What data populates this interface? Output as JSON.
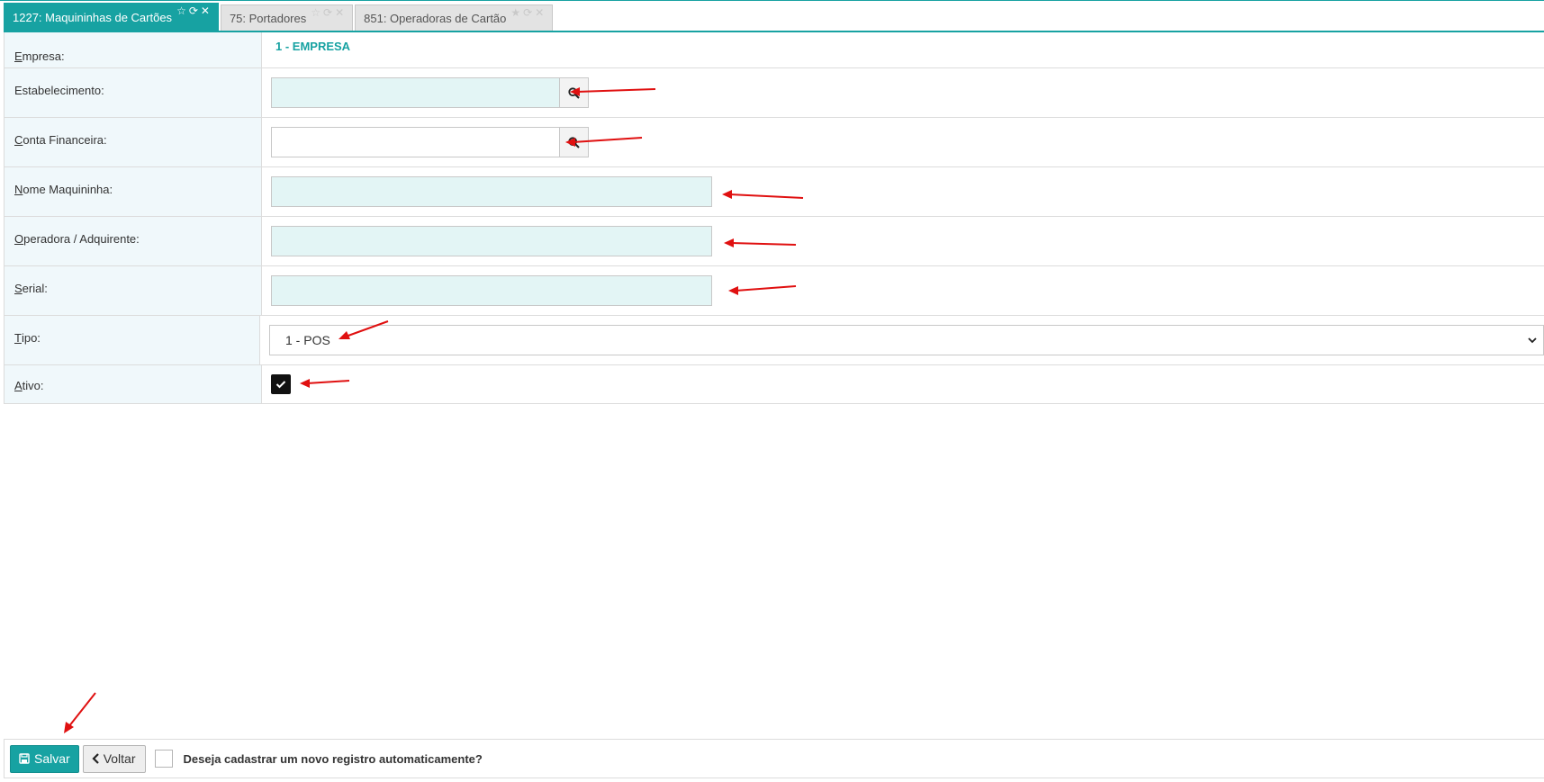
{
  "colors": {
    "accent": "#17a2a2",
    "annotation_arrow": "#e01010",
    "input_tint": "#e3f5f5",
    "label_bg": "#f0f8fb"
  },
  "tabs": [
    {
      "label": "1227: Maquininhas de Cartões",
      "active": true
    },
    {
      "label": "75: Portadores",
      "active": false
    },
    {
      "label": "851: Operadoras de Cartão",
      "active": false
    }
  ],
  "form": {
    "empresa": {
      "label_first": "E",
      "label_rest": "mpresa:",
      "value": "1 - EMPRESA"
    },
    "estabelecimento": {
      "label": "Estabelecimento:",
      "value": ""
    },
    "conta_financeira": {
      "label_first": "C",
      "label_rest": "onta Financeira:",
      "value": ""
    },
    "nome_maquininha": {
      "label_first": "N",
      "label_rest": "ome Maquininha:",
      "value": ""
    },
    "operadora": {
      "label_first": "O",
      "label_rest": "peradora / Adquirente:",
      "value": ""
    },
    "serial": {
      "label_first": "S",
      "label_rest": "erial:",
      "value": ""
    },
    "tipo": {
      "label_first": "T",
      "label_rest": "ipo:",
      "selected": "1 - POS"
    },
    "ativo": {
      "label_first": "A",
      "label_rest": "tivo:",
      "checked": true
    }
  },
  "footer": {
    "save_label": "Salvar",
    "back_label": "Voltar",
    "auto_register_label": "Deseja cadastrar um novo registro automaticamente?",
    "auto_register_checked": false
  },
  "icons": {
    "tab_star": "star-icon",
    "tab_refresh": "refresh-icon",
    "tab_close": "close-icon",
    "lookup": "search-icon",
    "select": "chevron-down-icon",
    "check": "check-icon",
    "save": "floppy-disk-icon",
    "back": "chevron-left-icon"
  }
}
